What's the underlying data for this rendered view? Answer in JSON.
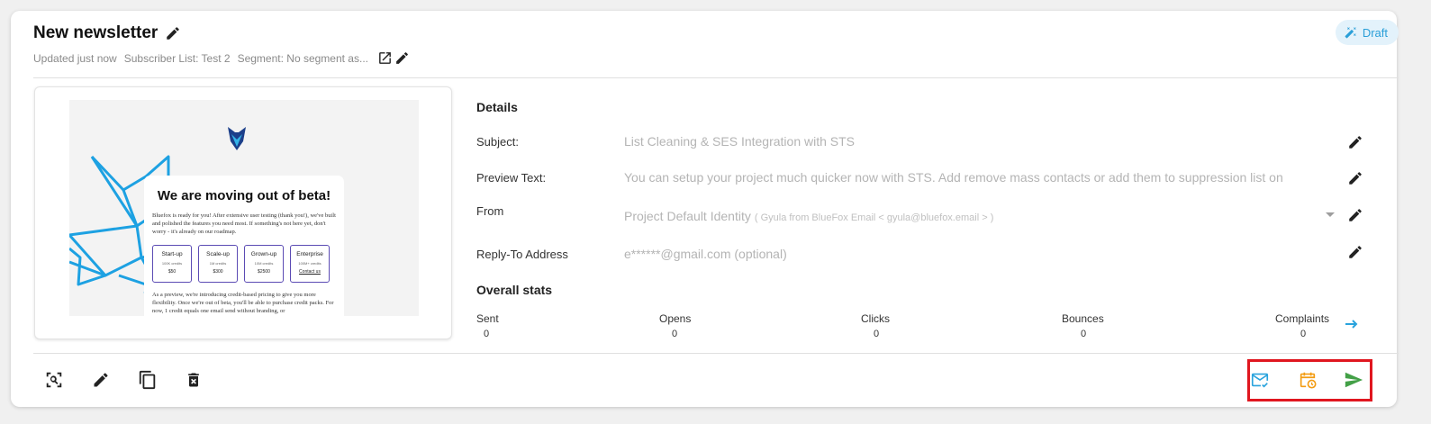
{
  "newsletter": {
    "title": "New newsletter",
    "updated": "Updated just now",
    "subscriber_list": "Subscriber List: Test 2",
    "segment": "Segment: No segment as...",
    "status_badge": "Draft"
  },
  "preview": {
    "heading": "We are moving out of beta!",
    "intro": "Bluefox is ready for you! After extensive user testing (thank you!), we've built and polished the features you need most. If something's not here yet, don't worry - it's already on our roadmap.",
    "tiers": [
      {
        "name": "Start-up",
        "credits": "100K credits",
        "price": "$50"
      },
      {
        "name": "Scale-up",
        "credits": "1M credits",
        "price": "$300"
      },
      {
        "name": "Grown-up",
        "credits": "10M credits",
        "price": "$2500"
      },
      {
        "name": "Enterprise",
        "credits": "100M+ credits",
        "price": "Contact us"
      }
    ],
    "outro": "As a preview, we're introducing credit-based pricing to give you more flexibility. Once we're out of beta, you'll be able to purchase credit packs. For now, 1 credit equals one email send without branding, or"
  },
  "details": {
    "section_title": "Details",
    "subject_label": "Subject:",
    "subject_value": "List Cleaning & SES Integration with STS",
    "preview_label": "Preview Text:",
    "preview_value": "You can setup your project much quicker now with STS. Add remove mass contacts or add them to suppression list on",
    "from_label": "From",
    "from_value": "Project Default Identity",
    "from_hint": "( Gyula from BlueFox Email < gyula@bluefox.email > )",
    "reply_label": "Reply-To Address",
    "reply_placeholder": "e******@gmail.com (optional)"
  },
  "stats": {
    "section_title": "Overall stats",
    "items": [
      {
        "label": "Sent",
        "value": "0"
      },
      {
        "label": "Opens",
        "value": "0"
      },
      {
        "label": "Clicks",
        "value": "0"
      },
      {
        "label": "Bounces",
        "value": "0"
      },
      {
        "label": "Complaints",
        "value": "0"
      }
    ]
  },
  "colors": {
    "draft_badge_bg": "#e3f2fb",
    "draft_badge_text": "#2a9fd8",
    "test_send_icon": "#29a3dd",
    "schedule_icon": "#f39c12",
    "send_icon": "#43a047",
    "highlight": "#e0161f"
  },
  "icons": {
    "title_edit": "pencil-icon",
    "open_segment": "external-link-icon",
    "segment_edit": "pencil-icon",
    "draft": "draft-icon",
    "stats_more": "arrow-right-icon",
    "actions": [
      "zoom-preview-icon",
      "pencil-icon",
      "copy-icon",
      "delete-icon",
      "test-send-icon",
      "schedule-icon",
      "send-icon"
    ]
  }
}
